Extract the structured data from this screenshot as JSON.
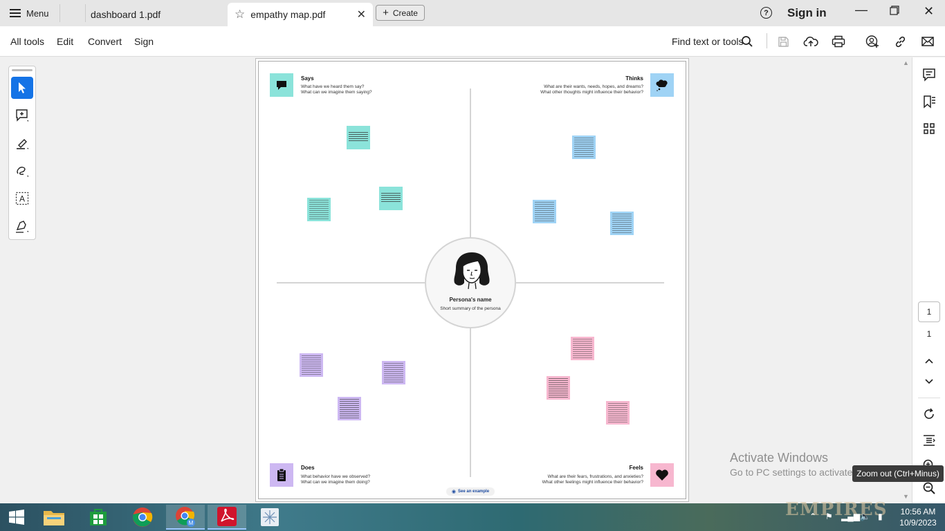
{
  "tabbar": {
    "menu_label": "Menu",
    "tabs": [
      {
        "label": "dashboard 1.pdf"
      },
      {
        "label": "empathy map.pdf"
      }
    ],
    "create_label": "Create",
    "signin_label": "Sign in"
  },
  "toolbar": {
    "menus": [
      "All tools",
      "Edit",
      "Convert",
      "Sign"
    ],
    "find_label": "Find text or tools"
  },
  "empathy_map": {
    "says": {
      "title": "Says",
      "line1": "What have we heard them say?",
      "line2": "What can we imagine them saying?"
    },
    "thinks": {
      "title": "Thinks",
      "line1": "What are their wants, needs, hopes, and dreams?",
      "line2": "What other thoughts might influence their behavior?"
    },
    "does": {
      "title": "Does",
      "line1": "What behavior have we observed?",
      "line2": "What can we imagine them doing?"
    },
    "feels": {
      "title": "Feels",
      "line1": "What are their fears, frustrations, and anxieties?",
      "line2": "What other feelings might influence their behavior?"
    },
    "persona_name": "Persona's name",
    "persona_summary": "Short summary of the persona",
    "see_example": "See an example"
  },
  "sidebar": {
    "page_current": "1",
    "page_total": "1"
  },
  "watermark": {
    "line1": "Activate Windows",
    "line2": "Go to PC settings to activate Windows."
  },
  "tooltip": "Zoom out (Ctrl+Minus)",
  "taskbar": {
    "time": "10:56 AM",
    "date": "10/9/2023"
  },
  "colors": {
    "accent": "#1473e6",
    "says": "#8be3da",
    "thinks": "#9fd3f5",
    "does": "#cdb8f2",
    "feels": "#f7b7cf",
    "acrobat_red": "#d0142c"
  }
}
